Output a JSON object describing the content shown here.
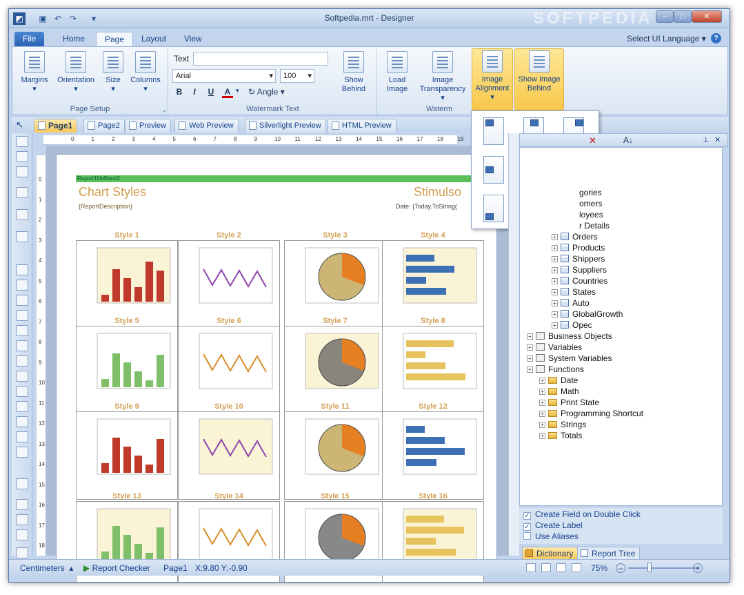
{
  "window": {
    "title": "Softpedia.mrt - Designer",
    "watermark": "SOFTPEDIA"
  },
  "ribbon_tabs": [
    {
      "label": "File"
    },
    {
      "label": "Home"
    },
    {
      "label": "Page"
    },
    {
      "label": "Layout"
    },
    {
      "label": "View"
    }
  ],
  "ui_language": "Select UI Language",
  "page_setup": {
    "group_label": "Page Setup",
    "margins": "Margins",
    "orientation": "Orientation",
    "size": "Size",
    "columns": "Columns"
  },
  "watermark_text": {
    "group_label": "Watermark Text",
    "text_label": "Text",
    "text_value": "",
    "font": "Arial",
    "font_size": "100",
    "bold": "B",
    "italic": "I",
    "underline": "U",
    "color": "A",
    "angle": "Angle",
    "show_behind": "Show Behind"
  },
  "watermark_image": {
    "group_label": "Waterm",
    "load_image": "Load Image",
    "transparency": "Image Transparency",
    "alignment": "Image Alignment",
    "show_image_behind": "Show Image Behind"
  },
  "doc_tabs": [
    {
      "label": "Page1"
    },
    {
      "label": "Page2"
    },
    {
      "label": "Preview"
    },
    {
      "label": "Web Preview"
    },
    {
      "label": "Silverlight Preview"
    },
    {
      "label": "HTML Preview"
    }
  ],
  "report": {
    "band": "ReportTitleBand2",
    "title": "Chart Styles",
    "title_right": "Stimulso",
    "description": "{ReportDescription}",
    "date": "Date: {Today.ToString(",
    "styles": [
      "Style 1",
      "Style 2",
      "Style 3",
      "Style 4",
      "Style 5",
      "Style 6",
      "Style 7",
      "Style 8",
      "Style 9",
      "Style 10",
      "Style 11",
      "Style 12",
      "Style 13",
      "Style 14",
      "Style 15",
      "Style 16"
    ]
  },
  "tree": [
    {
      "label": "gories",
      "kind": "fld"
    },
    {
      "label": "omers",
      "kind": "fld"
    },
    {
      "label": "loyees",
      "kind": "fld"
    },
    {
      "label": "r Details",
      "kind": "fld"
    },
    {
      "label": "Orders",
      "kind": "tbl"
    },
    {
      "label": "Products",
      "kind": "tbl"
    },
    {
      "label": "Shippers",
      "kind": "tbl"
    },
    {
      "label": "Suppliers",
      "kind": "tbl"
    },
    {
      "label": "Countries",
      "kind": "tbl"
    },
    {
      "label": "States",
      "kind": "tbl"
    },
    {
      "label": "Auto",
      "kind": "tbl"
    },
    {
      "label": "GlobalGrowth",
      "kind": "tbl"
    },
    {
      "label": "Opec",
      "kind": "tbl"
    },
    {
      "label": "Business Objects",
      "kind": "top"
    },
    {
      "label": "Variables",
      "kind": "top"
    },
    {
      "label": "System Variables",
      "kind": "top"
    },
    {
      "label": "Functions",
      "kind": "top"
    },
    {
      "label": "Date",
      "kind": "func"
    },
    {
      "label": "Math",
      "kind": "func"
    },
    {
      "label": "Print State",
      "kind": "func"
    },
    {
      "label": "Programming Shortcut",
      "kind": "func"
    },
    {
      "label": "Strings",
      "kind": "func"
    },
    {
      "label": "Totals",
      "kind": "func"
    }
  ],
  "options": [
    {
      "label": "Create Field on Double Click",
      "checked": true
    },
    {
      "label": "Create Label",
      "checked": true
    },
    {
      "label": "Use Aliases",
      "checked": false
    }
  ],
  "dict_tabs": [
    {
      "label": "Dictionary"
    },
    {
      "label": "Report Tree"
    }
  ],
  "status": {
    "units": "Centimeters",
    "checker": "Report Checker",
    "page": "Page1",
    "coords": "X:9.80  Y:-0.90",
    "zoom": "75%"
  },
  "colors": {
    "accent": "#f8c84a",
    "ribbon": "#c3d5ec",
    "title_orange": "#d39e52"
  }
}
